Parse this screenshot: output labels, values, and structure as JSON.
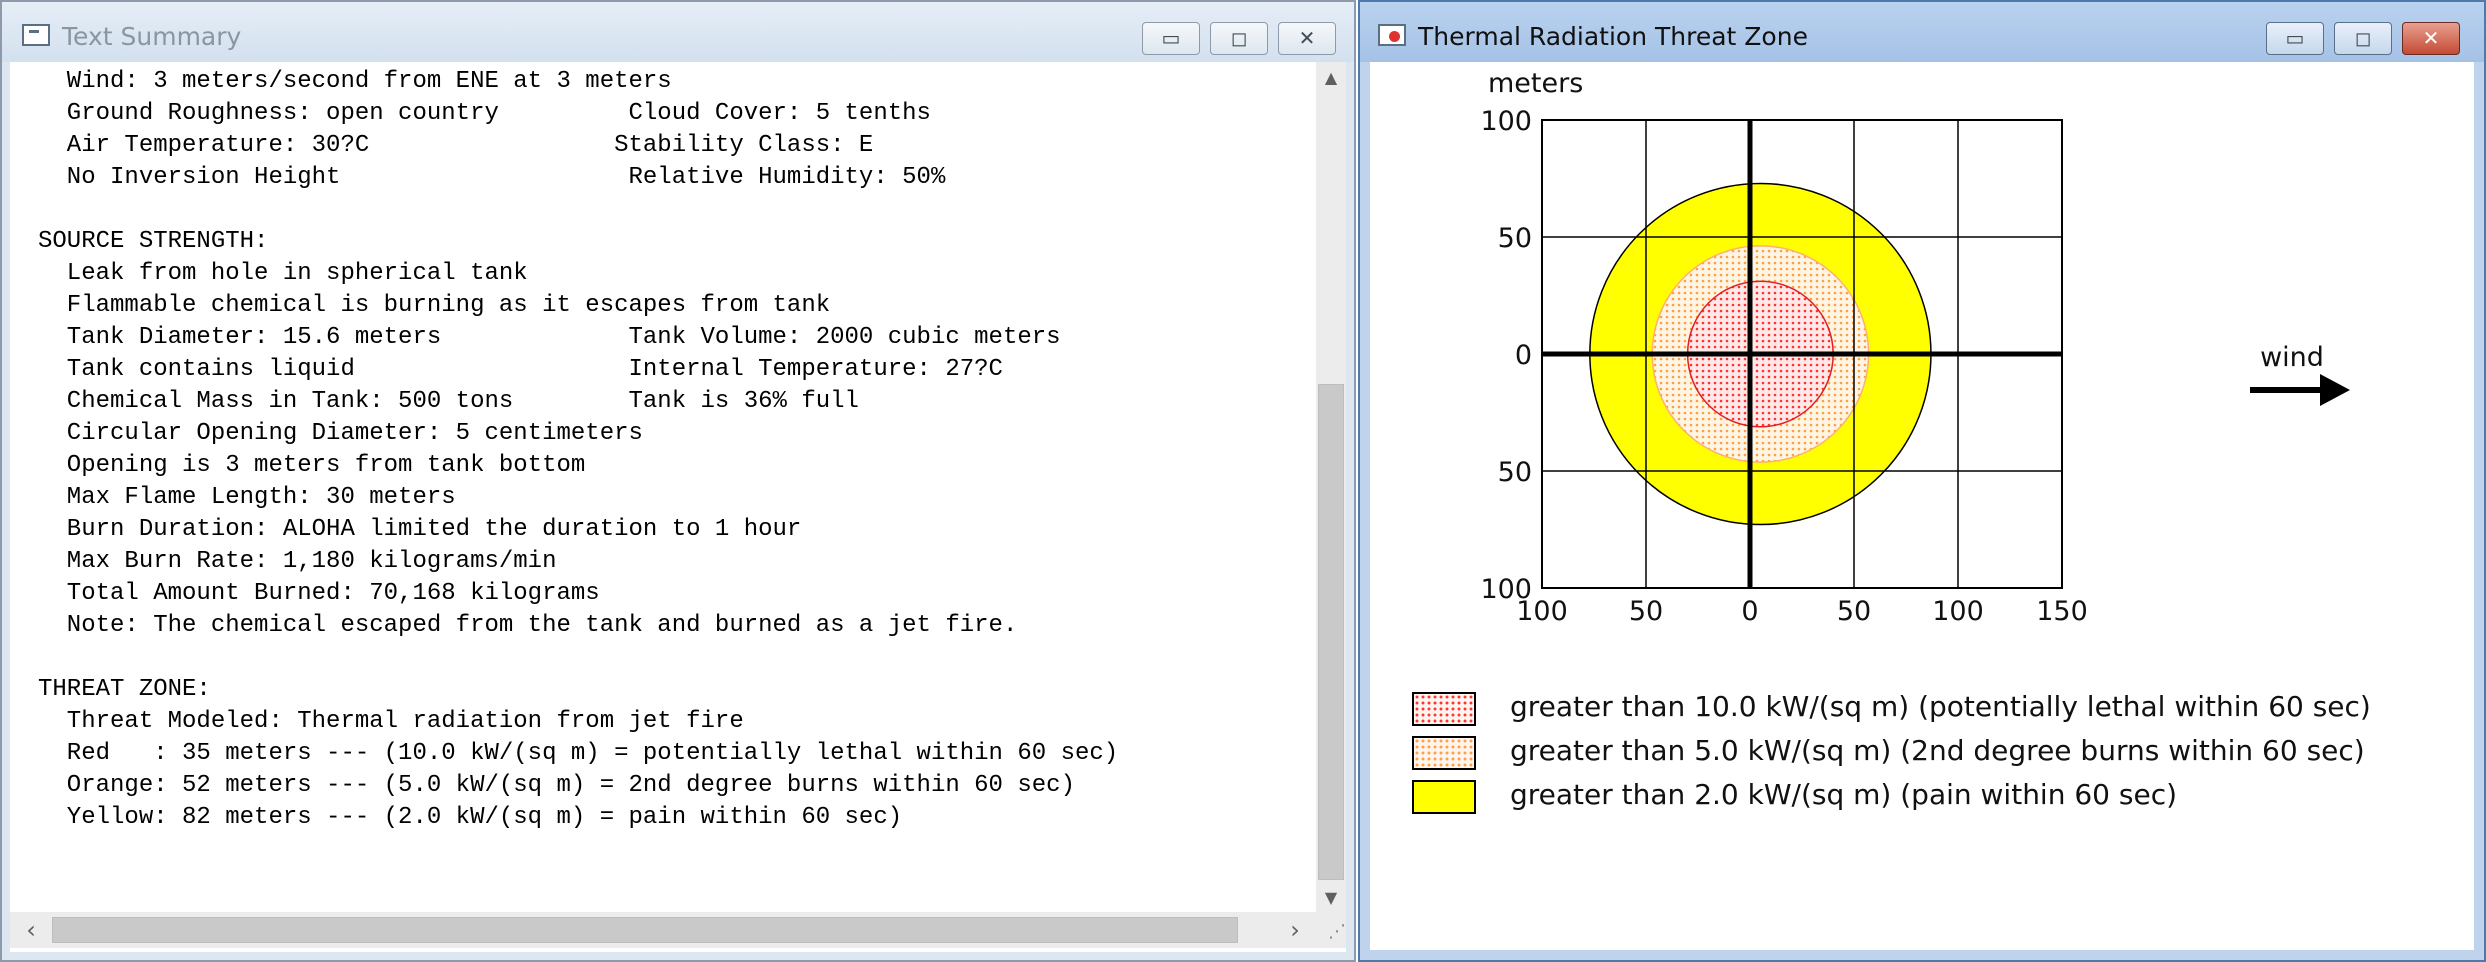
{
  "text_window": {
    "title": "Text Summary",
    "controls": {
      "minimize": "▭",
      "maximize": "◻",
      "close": "✕"
    },
    "lines": [
      "  Wind: 3 meters/second from ENE at 3 meters",
      "  Ground Roughness: open country         Cloud Cover: 5 tenths",
      "  Air Temperature: 30?C                 Stability Class: E",
      "  No Inversion Height                    Relative Humidity: 50%",
      "",
      "SOURCE STRENGTH:",
      "  Leak from hole in spherical tank",
      "  Flammable chemical is burning as it escapes from tank",
      "  Tank Diameter: 15.6 meters             Tank Volume: 2000 cubic meters",
      "  Tank contains liquid                   Internal Temperature: 27?C",
      "  Chemical Mass in Tank: 500 tons        Tank is 36% full",
      "  Circular Opening Diameter: 5 centimeters",
      "  Opening is 3 meters from tank bottom",
      "  Max Flame Length: 30 meters",
      "  Burn Duration: ALOHA limited the duration to 1 hour",
      "  Max Burn Rate: 1,180 kilograms/min",
      "  Total Amount Burned: 70,168 kilograms",
      "  Note: The chemical escaped from the tank and burned as a jet fire.",
      "",
      "THREAT ZONE:",
      "  Threat Modeled: Thermal radiation from jet fire",
      "  Red   : 35 meters --- (10.0 kW/(sq m) = potentially lethal within 60 sec)",
      "  Orange: 52 meters --- (5.0 kW/(sq m) = 2nd degree burns within 60 sec)",
      "  Yellow: 82 meters --- (2.0 kW/(sq m) = pain within 60 sec)"
    ],
    "scroll_arrows": {
      "up": "▲",
      "down": "▼",
      "left": "‹",
      "right": "›"
    },
    "grip": "⋰"
  },
  "threat_window": {
    "title": "Thermal Radiation Threat Zone",
    "controls": {
      "minimize": "▭",
      "maximize": "◻",
      "close": "✕"
    },
    "legend": [
      {
        "label": "greater than 10.0 kW/(sq m) (potentially lethal within 60 sec)",
        "color": "#ff3333",
        "pattern": "dots"
      },
      {
        "label": "greater than 5.0 kW/(sq m) (2nd degree burns within 60 sec)",
        "color": "#ffa040",
        "pattern": "dots"
      },
      {
        "label": "greater than 2.0 kW/(sq m) (pain within 60 sec)",
        "color": "#ffff00",
        "pattern": "solid"
      }
    ]
  },
  "chart_data": {
    "type": "threat-zone",
    "xlabel": "meters",
    "ylabel": "meters",
    "xlim": [
      -100,
      150
    ],
    "ylim": [
      -100,
      100
    ],
    "x_ticks": [
      -100,
      -50,
      0,
      50,
      100,
      150
    ],
    "y_ticks": [
      100,
      50,
      0,
      -50,
      -100
    ],
    "x_tick_labels": [
      "100",
      "50",
      "0",
      "50",
      "100",
      "150"
    ],
    "y_tick_labels": [
      "100",
      "50",
      "0",
      "50",
      "100"
    ],
    "grid": true,
    "wind_label": "wind",
    "wind_direction": "right",
    "zones": [
      {
        "name": "Yellow",
        "radius_m": 82,
        "center": [
          5,
          0
        ],
        "fill": "#ffff00",
        "stroke": "#000000",
        "pattern": "solid"
      },
      {
        "name": "Orange",
        "radius_m": 52,
        "center": [
          5,
          0
        ],
        "fill": "#ffa040",
        "stroke": "#ffb070",
        "pattern": "dots"
      },
      {
        "name": "Red",
        "radius_m": 35,
        "center": [
          5,
          0
        ],
        "fill": "#ff3333",
        "stroke": "#e02020",
        "pattern": "dots"
      }
    ],
    "colors": {
      "axis": "#000000",
      "grid": "#000000",
      "background": "#ffffff"
    }
  }
}
